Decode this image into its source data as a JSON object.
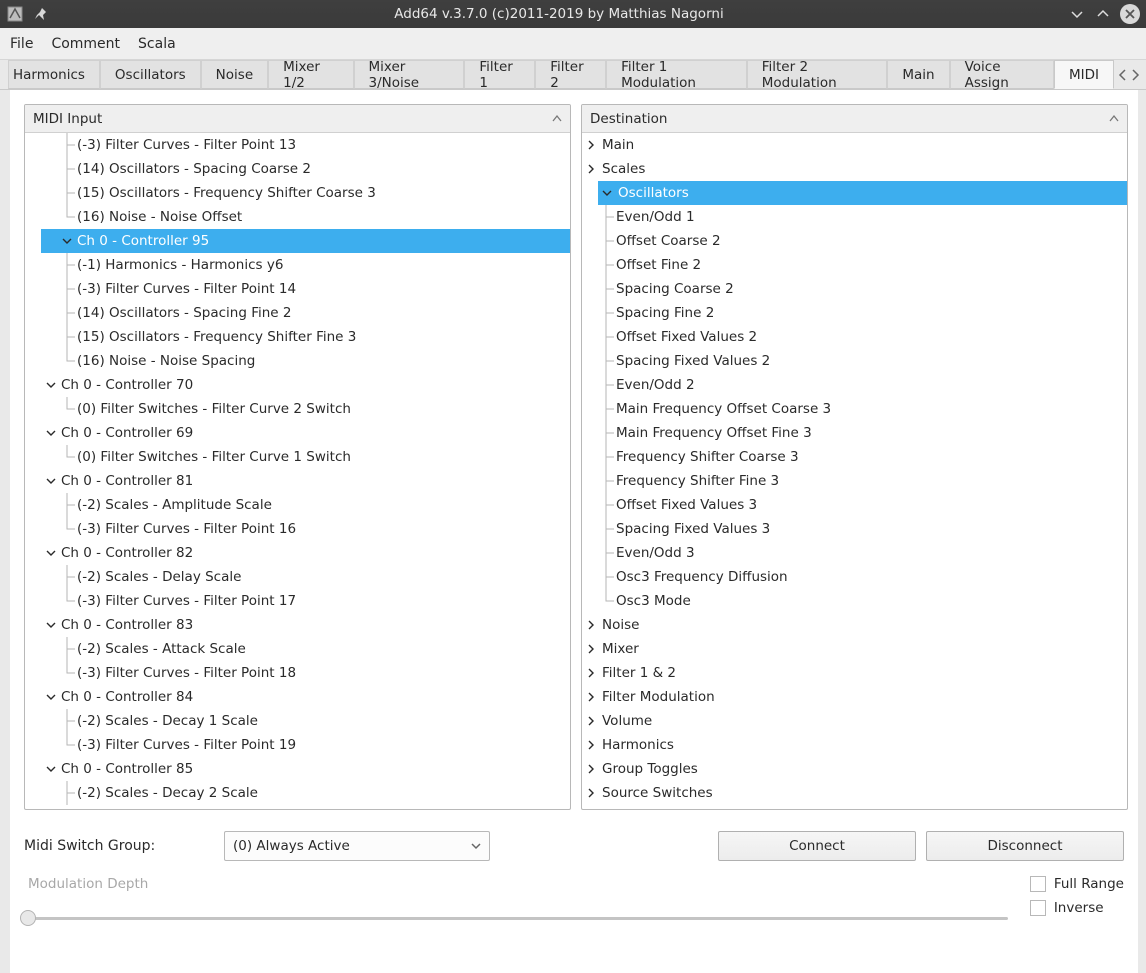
{
  "window": {
    "title": "Add64  v.3.7.0   (c)2011-2019 by Matthias Nagorni"
  },
  "menu": {
    "file": "File",
    "comment": "Comment",
    "scala": "Scala"
  },
  "tabs": [
    {
      "label": "Harmonics"
    },
    {
      "label": "Oscillators"
    },
    {
      "label": "Noise"
    },
    {
      "label": "Mixer 1/2"
    },
    {
      "label": "Mixer 3/Noise"
    },
    {
      "label": "Filter 1"
    },
    {
      "label": "Filter 2"
    },
    {
      "label": "Filter 1 Modulation"
    },
    {
      "label": "Filter 2 Modulation"
    },
    {
      "label": "Main"
    },
    {
      "label": "Voice Assign"
    },
    {
      "label": "MIDI"
    }
  ],
  "midiInput": {
    "header": "MIDI Input",
    "rows": [
      {
        "depth": 2,
        "type": "leaf",
        "last": false,
        "text": "(-3) Filter Curves - Filter Point 13"
      },
      {
        "depth": 2,
        "type": "leaf",
        "last": false,
        "text": "(14) Oscillators - Spacing Coarse 2"
      },
      {
        "depth": 2,
        "type": "leaf",
        "last": false,
        "text": "(15) Oscillators - Frequency Shifter Coarse 3"
      },
      {
        "depth": 2,
        "type": "leaf",
        "last": true,
        "text": "(16) Noise - Noise Offset"
      },
      {
        "depth": 1,
        "type": "open",
        "selected": true,
        "text": "Ch 0 - Controller 95"
      },
      {
        "depth": 2,
        "type": "leaf",
        "last": false,
        "text": "(-1) Harmonics - Harmonics y6"
      },
      {
        "depth": 2,
        "type": "leaf",
        "last": false,
        "text": "(-3) Filter Curves - Filter Point 14"
      },
      {
        "depth": 2,
        "type": "leaf",
        "last": false,
        "text": "(14) Oscillators - Spacing Fine 2"
      },
      {
        "depth": 2,
        "type": "leaf",
        "last": false,
        "text": "(15) Oscillators - Frequency Shifter Fine 3"
      },
      {
        "depth": 2,
        "type": "leaf",
        "last": true,
        "text": "(16) Noise - Noise Spacing"
      },
      {
        "depth": 1,
        "type": "open",
        "text": "Ch 0 - Controller 70"
      },
      {
        "depth": 2,
        "type": "leaf",
        "last": true,
        "text": "(0) Filter Switches - Filter Curve 2  Switch"
      },
      {
        "depth": 1,
        "type": "open",
        "text": "Ch 0 - Controller 69"
      },
      {
        "depth": 2,
        "type": "leaf",
        "last": true,
        "text": "(0) Filter Switches - Filter Curve 1  Switch"
      },
      {
        "depth": 1,
        "type": "open",
        "text": "Ch 0 - Controller 81"
      },
      {
        "depth": 2,
        "type": "leaf",
        "last": false,
        "text": "(-2) Scales - Amplitude Scale"
      },
      {
        "depth": 2,
        "type": "leaf",
        "last": true,
        "text": "(-3) Filter Curves - Filter Point 16"
      },
      {
        "depth": 1,
        "type": "open",
        "text": "Ch 0 - Controller 82"
      },
      {
        "depth": 2,
        "type": "leaf",
        "last": false,
        "text": "(-2) Scales - Delay Scale"
      },
      {
        "depth": 2,
        "type": "leaf",
        "last": true,
        "text": "(-3) Filter Curves - Filter Point 17"
      },
      {
        "depth": 1,
        "type": "open",
        "text": "Ch 0 - Controller 83"
      },
      {
        "depth": 2,
        "type": "leaf",
        "last": false,
        "text": "(-2) Scales - Attack Scale"
      },
      {
        "depth": 2,
        "type": "leaf",
        "last": true,
        "text": "(-3) Filter Curves - Filter Point 18"
      },
      {
        "depth": 1,
        "type": "open",
        "text": "Ch 0 - Controller 84"
      },
      {
        "depth": 2,
        "type": "leaf",
        "last": false,
        "text": "(-2) Scales - Decay 1 Scale"
      },
      {
        "depth": 2,
        "type": "leaf",
        "last": true,
        "text": "(-3) Filter Curves - Filter Point 19"
      },
      {
        "depth": 1,
        "type": "open",
        "text": "Ch 0 - Controller 85"
      },
      {
        "depth": 2,
        "type": "leaf",
        "last": false,
        "text": "(-2) Scales - Decay 2 Scale"
      }
    ]
  },
  "destination": {
    "header": "Destination",
    "rows": [
      {
        "depth": 0,
        "type": "closed",
        "text": "Main"
      },
      {
        "depth": 0,
        "type": "closed",
        "text": "Scales"
      },
      {
        "depth": 0,
        "type": "open",
        "selected": true,
        "text": "Oscillators"
      },
      {
        "depth": 1,
        "type": "leaf",
        "last": false,
        "text": "Even/Odd 1"
      },
      {
        "depth": 1,
        "type": "leaf",
        "last": false,
        "text": "Offset Coarse 2"
      },
      {
        "depth": 1,
        "type": "leaf",
        "last": false,
        "text": "Offset Fine 2"
      },
      {
        "depth": 1,
        "type": "leaf",
        "last": false,
        "text": "Spacing Coarse 2"
      },
      {
        "depth": 1,
        "type": "leaf",
        "last": false,
        "text": "Spacing Fine 2"
      },
      {
        "depth": 1,
        "type": "leaf",
        "last": false,
        "text": "Offset Fixed Values 2"
      },
      {
        "depth": 1,
        "type": "leaf",
        "last": false,
        "text": "Spacing Fixed Values 2"
      },
      {
        "depth": 1,
        "type": "leaf",
        "last": false,
        "text": "Even/Odd 2"
      },
      {
        "depth": 1,
        "type": "leaf",
        "last": false,
        "text": "Main Frequency Offset Coarse 3"
      },
      {
        "depth": 1,
        "type": "leaf",
        "last": false,
        "text": "Main Frequency Offset Fine 3"
      },
      {
        "depth": 1,
        "type": "leaf",
        "last": false,
        "text": "Frequency Shifter Coarse 3"
      },
      {
        "depth": 1,
        "type": "leaf",
        "last": false,
        "text": "Frequency Shifter Fine 3"
      },
      {
        "depth": 1,
        "type": "leaf",
        "last": false,
        "text": "Offset Fixed Values 3"
      },
      {
        "depth": 1,
        "type": "leaf",
        "last": false,
        "text": "Spacing Fixed Values 3"
      },
      {
        "depth": 1,
        "type": "leaf",
        "last": false,
        "text": "Even/Odd 3"
      },
      {
        "depth": 1,
        "type": "leaf",
        "last": false,
        "text": "Osc3 Frequency Diffusion"
      },
      {
        "depth": 1,
        "type": "leaf",
        "last": true,
        "text": "Osc3 Mode"
      },
      {
        "depth": 0,
        "type": "closed",
        "text": "Noise"
      },
      {
        "depth": 0,
        "type": "closed",
        "text": "Mixer"
      },
      {
        "depth": 0,
        "type": "closed",
        "text": "Filter 1 & 2"
      },
      {
        "depth": 0,
        "type": "closed",
        "text": "Filter Modulation"
      },
      {
        "depth": 0,
        "type": "closed",
        "text": "Volume"
      },
      {
        "depth": 0,
        "type": "closed",
        "text": "Harmonics"
      },
      {
        "depth": 0,
        "type": "closed",
        "text": "Group Toggles"
      },
      {
        "depth": 0,
        "type": "closed",
        "text": "Source Switches"
      }
    ]
  },
  "bottom": {
    "midiSwitchGroupLabel": "Midi Switch Group:",
    "comboValue": "(0) Always Active",
    "connect": "Connect",
    "disconnect": "Disconnect",
    "modDepth": "Modulation Depth",
    "fullRange": "Full Range",
    "inverse": "Inverse"
  }
}
